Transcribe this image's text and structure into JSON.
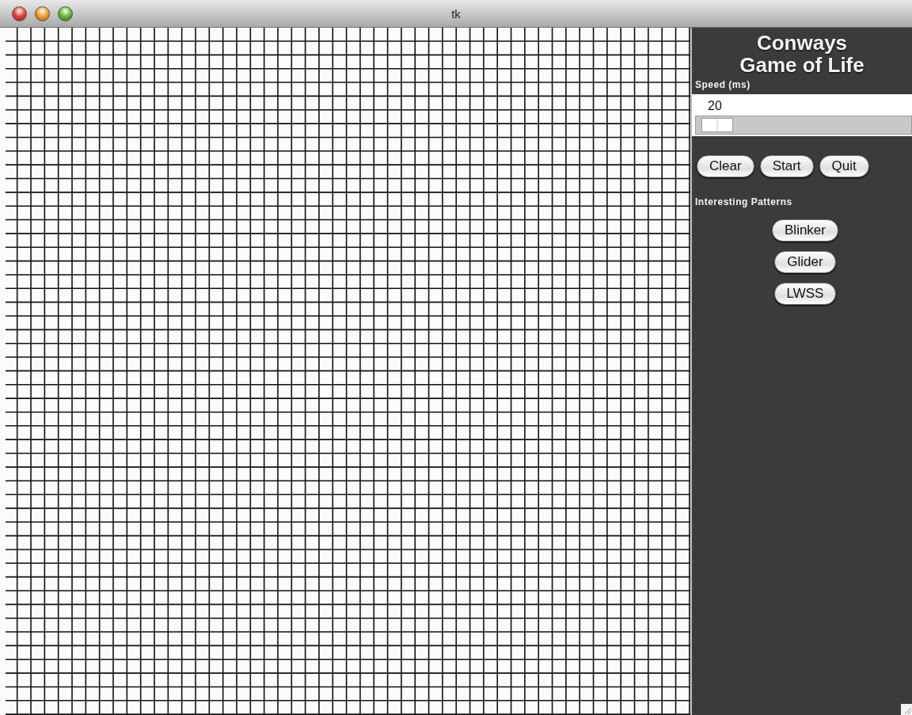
{
  "window": {
    "title": "tk"
  },
  "panel": {
    "title_lines": [
      "Conways",
      "Game of Life"
    ],
    "speed": {
      "label": "Speed (ms)",
      "value": "20",
      "level": 0.02
    },
    "buttons": [
      "Clear",
      "Start",
      "Quit"
    ],
    "patterns_label": "Interesting Patterns",
    "patterns": [
      "Blinker",
      "Glider",
      "LWSS"
    ]
  }
}
